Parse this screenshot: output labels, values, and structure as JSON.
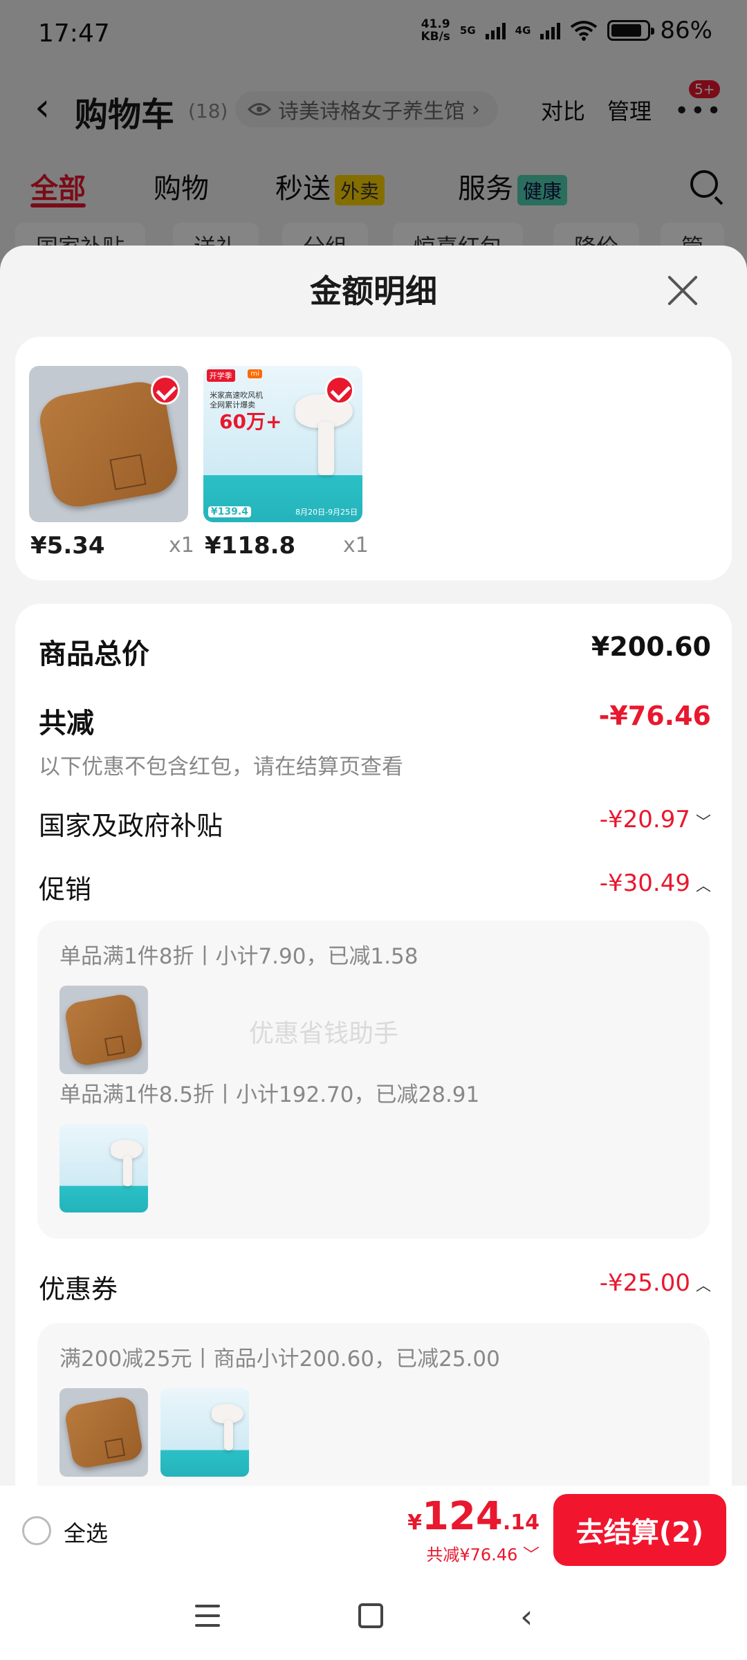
{
  "status_bar": {
    "time": "17:47",
    "net_speed_value": "41.9",
    "net_speed_unit": "KB/s",
    "signal_1": "5G",
    "signal_2": "4G",
    "battery": "86%",
    "battery_level": 0.86
  },
  "cart_header": {
    "back_glyph": "‹",
    "title": "购物车",
    "count": "(18)",
    "shop_name": "诗美诗格女子养生馆",
    "shop_chevron": "›",
    "compare": "对比",
    "manage": "管理",
    "more_glyph": "•••",
    "msg_badge": "5+"
  },
  "tabs": [
    {
      "label": "全部",
      "tag": ""
    },
    {
      "label": "购物",
      "tag": ""
    },
    {
      "label": "秒送",
      "tag": "外卖"
    },
    {
      "label": "服务",
      "tag": "健康"
    }
  ],
  "filter_chips": [
    "国家补贴",
    "送礼",
    "分组",
    "惊喜红包",
    "降价",
    "管"
  ],
  "sheet": {
    "title": "金额明细",
    "items": [
      {
        "price": "¥5.34",
        "qty": "x1",
        "icon": "mat-product-image",
        "selected": true
      },
      {
        "price": "¥118.8",
        "qty": "x1",
        "icon": "hair-dryer-product-image",
        "selected": true
      }
    ],
    "product_art": {
      "dryer_tag": "开学季",
      "dryer_brand": "mi",
      "dryer_line1": "米家高速吹风机",
      "dryer_line2": "全网累计爆卖",
      "dryer_big": "60万+",
      "dryer_price": "¥139.4",
      "dryer_date": "8月20日-9月25日"
    },
    "total_label": "商品总价",
    "total_value": "¥200.60",
    "discount_label": "共减",
    "discount_value": "-¥76.46",
    "discount_note": "以下优惠不包含红包，请在结算页查看",
    "watermark": "优惠省钱助手",
    "subsidy_label": "国家及政府补贴",
    "subsidy_value": "-¥20.97",
    "promo_label": "促销",
    "promo_value": "-¥30.49",
    "promo_line1": "单品满1件8折丨小计7.90，已减1.58",
    "promo_line2": "单品满1件8.5折丨小计192.70，已减28.91",
    "coupon_label": "优惠券",
    "coupon_value": "-¥25.00",
    "coupon_line": "满200减25元丨商品小计200.60，已减25.00",
    "chevron_down": "﹀",
    "chevron_up": "︿"
  },
  "bottom_bar": {
    "select_all": "全选",
    "price_yen": "¥",
    "price_int": "124",
    "price_dec": ".14",
    "saving": "共减¥76.46 ﹀",
    "checkout": "去结算(2)"
  },
  "colors": {
    "accent": "#e8182e",
    "overlay": "rgba(0,0,0,0.48)"
  }
}
